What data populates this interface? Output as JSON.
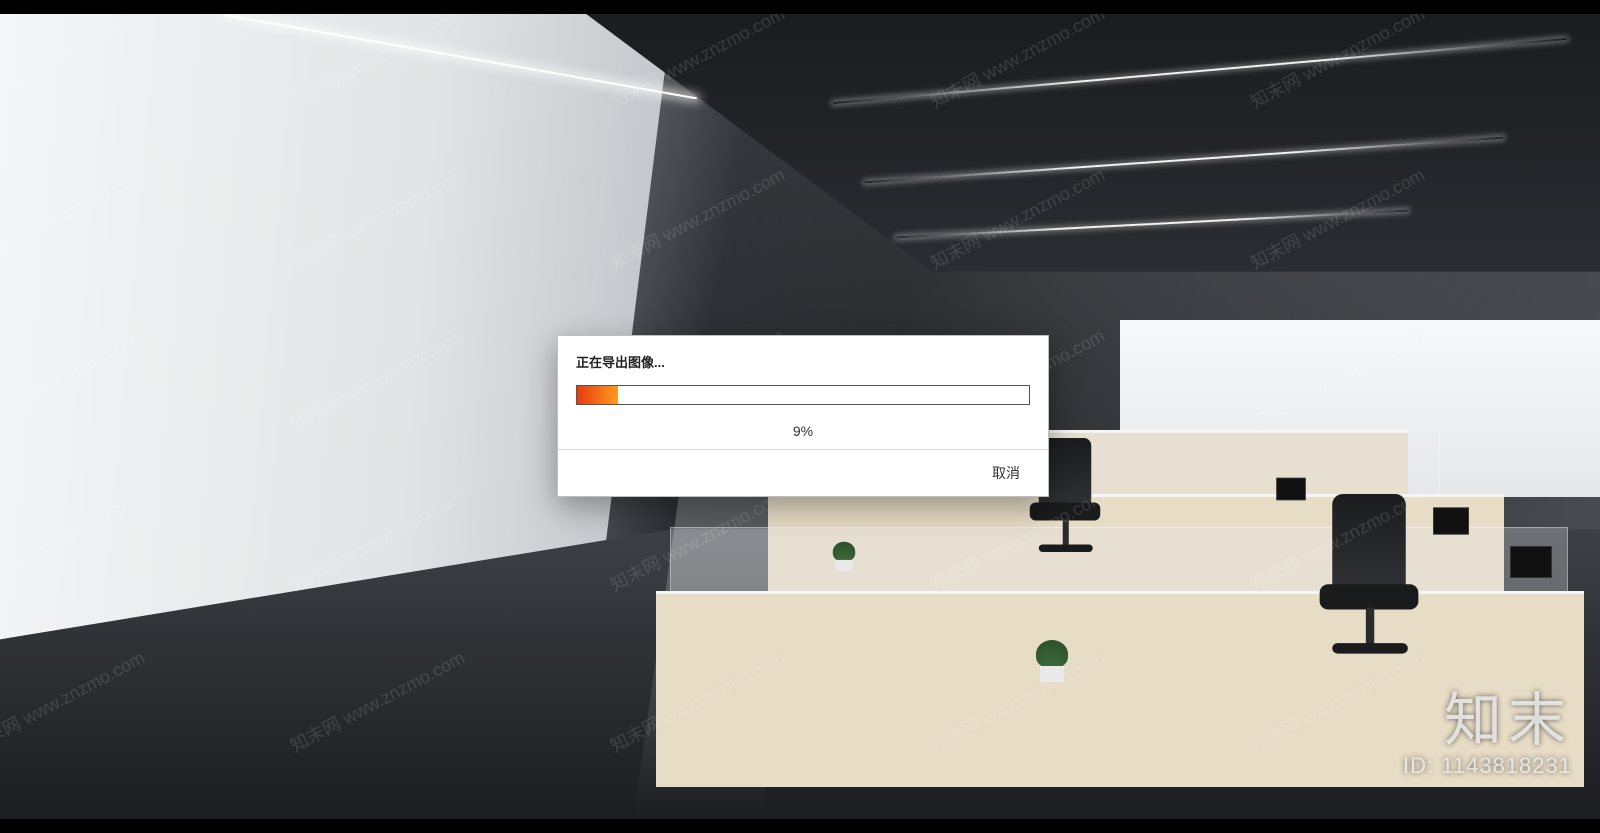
{
  "dialog": {
    "title": "正在导出图像...",
    "progress_percent": 9,
    "percent_label": "9%",
    "cancel_label": "取消"
  },
  "watermark": {
    "text": "知末网 www.znzmo.com"
  },
  "brand": {
    "logo_text": "知末",
    "id_prefix": "ID:",
    "id_value": "1143818231"
  },
  "colors": {
    "progress_start": "#e63b0f",
    "progress_end": "#ff9a1f",
    "dialog_border": "#bfbfbf"
  }
}
